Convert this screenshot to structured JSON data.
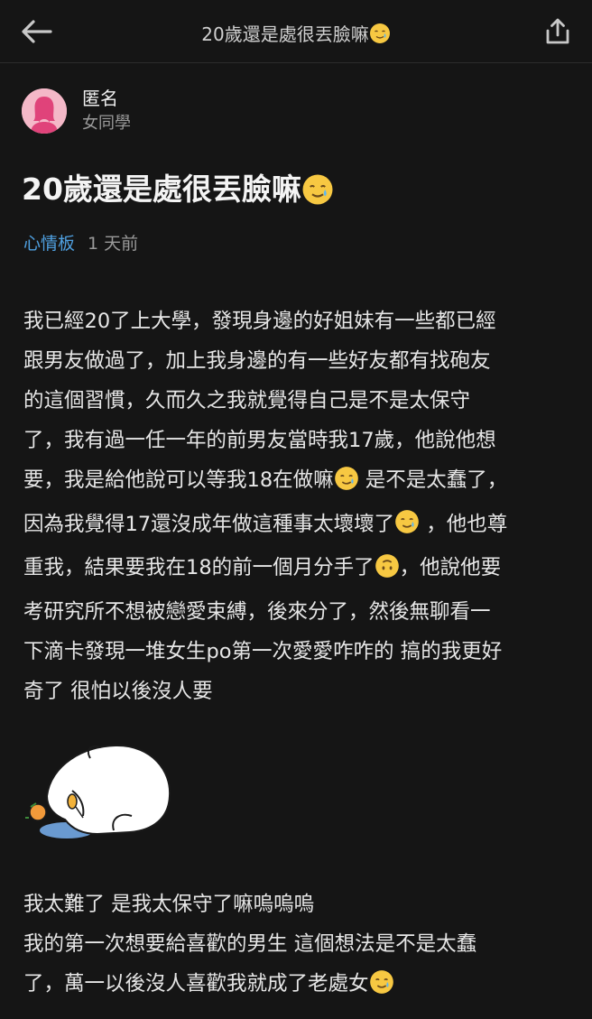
{
  "header": {
    "title": "20歲還是處很丟臉嘛",
    "title_emoji": "🥲",
    "back_icon": "arrow-left-icon",
    "share_icon": "share-icon"
  },
  "author": {
    "name": "匿名",
    "school": "女同學",
    "avatar_icon": "female-avatar-icon",
    "avatar_color": "#f4b8c8"
  },
  "post": {
    "title": "20歲還是處很丟臉嘛",
    "board": "心情板",
    "time": "1 天前",
    "paragraph1": [
      "我已經20了上大學，發現身邊的好姐妹有一些都已經",
      "跟男友做過了，加上我身邊的有一些好友都有找砲友",
      "的這個習慣，久而久之我就覺得自己是不是太保守",
      "了，我有過一任一年的前男友當時我17歲，他說他想",
      "要，我是給他說可以等我18在做嘛",
      " 是不是太蠢了，",
      "因為我覺得17還沒成年做這種事太壞壞了",
      " ，他也尊",
      "重我，結果要我在18的前一個月分手了",
      "，他說他要",
      "考研究所不想被戀愛束縛，後來分了，然後無聊看一",
      "下滴卡發現一堆女生po第一次愛愛咋咋的 搞的我更好",
      "奇了 很怕以後沒人要"
    ],
    "sticker_icon": "crying-bunny-sticker-icon",
    "paragraph2": [
      "我太難了 是我太保守了嘛嗚嗚嗚",
      "我的第一次想要給喜歡的男生 這個想法是不是太蠢",
      "了，萬一以後沒人喜歡我就成了老處女"
    ]
  },
  "colors": {
    "background": "#151515",
    "accent_link": "#4fa0e0",
    "muted_text": "#9a9a9a"
  }
}
